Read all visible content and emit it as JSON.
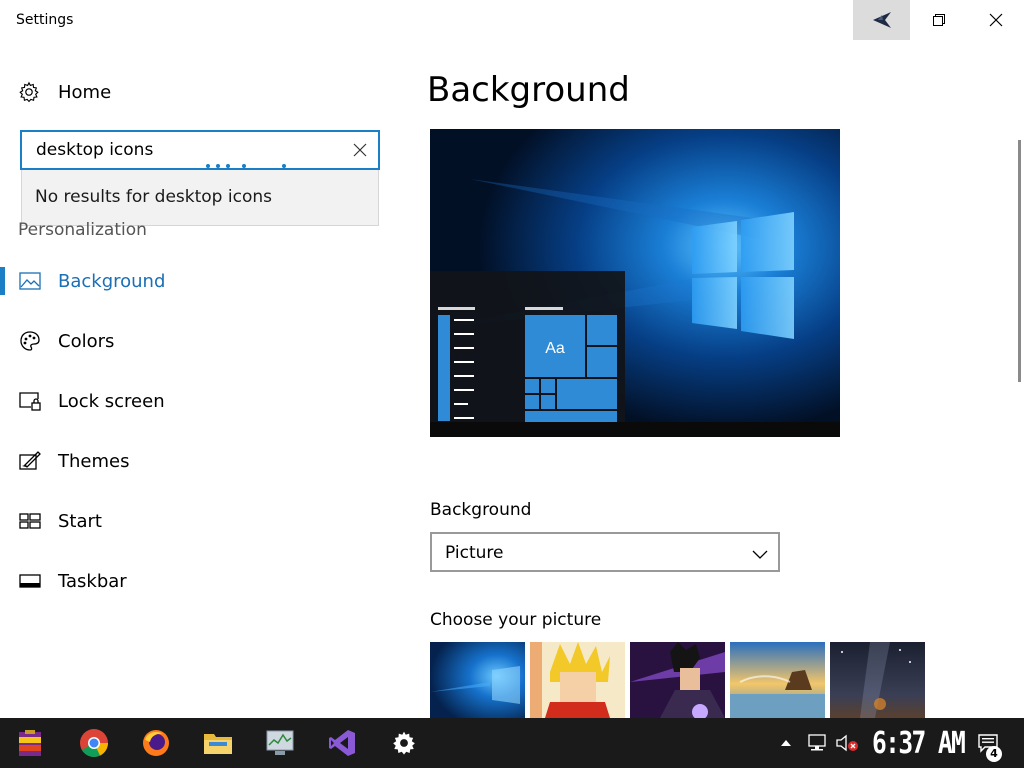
{
  "window": {
    "title": "Settings",
    "pin_icon": "pin-icon",
    "restore_icon": "restore-icon",
    "close_icon": "close-icon"
  },
  "nav": {
    "home_label": "Home",
    "home_icon": "gear-icon",
    "search": {
      "value": "desktop icons",
      "placeholder": "",
      "no_results": "No results for desktop icons"
    },
    "section_title": "Personalization",
    "items": [
      {
        "label": "Background",
        "icon": "picture-icon",
        "active": true
      },
      {
        "label": "Colors",
        "icon": "palette-icon",
        "active": false
      },
      {
        "label": "Lock screen",
        "icon": "lock-screen-icon",
        "active": false
      },
      {
        "label": "Themes",
        "icon": "themes-icon",
        "active": false
      },
      {
        "label": "Start",
        "icon": "start-icon",
        "active": false
      },
      {
        "label": "Taskbar",
        "icon": "taskbar-icon",
        "active": false
      }
    ]
  },
  "main": {
    "title": "Background",
    "preview_tile_text": "Aa",
    "background_label": "Background",
    "background_value": "Picture",
    "choose_label": "Choose your picture"
  },
  "taskbar": {
    "apps": [
      "winrar-icon",
      "chrome-icon",
      "firefox-icon",
      "file-explorer-icon",
      "task-manager-icon",
      "visual-studio-icon",
      "settings-icon"
    ],
    "clock": "6:37 AM",
    "notification_count": "4"
  },
  "colors": {
    "accent": "#1a7fc4",
    "taskbar": "#1a1a1a"
  }
}
